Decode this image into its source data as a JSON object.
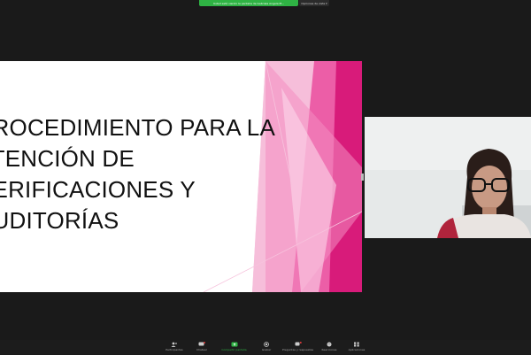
{
  "top_bar": {
    "share_banner": "Usted está viendo la pantalla de Gabriela Angela M...",
    "view_options": "Opciones de vista"
  },
  "slide": {
    "title_lines": [
      "PROCEDIMIENTO PARA LA",
      "ATENCIÓN DE",
      "VERIFICACIONES Y",
      "AUDITORÍAS"
    ],
    "accent_color": "#d81b7a"
  },
  "video": {
    "participant_background": "#e9ecec"
  },
  "toolbar": {
    "items": [
      {
        "label": "Participantes",
        "icon": "participants-icon",
        "badge": "17"
      },
      {
        "label": "Chatear",
        "icon": "chat-icon",
        "badge": "1"
      },
      {
        "label": "Compartir pantalla",
        "icon": "share-screen-icon"
      },
      {
        "label": "Grabar",
        "icon": "record-icon"
      },
      {
        "label": "Preguntas y respuestas",
        "icon": "qa-icon"
      },
      {
        "label": "Reacciones",
        "icon": "reactions-icon"
      },
      {
        "label": "Aplicaciones",
        "icon": "apps-icon"
      }
    ]
  }
}
